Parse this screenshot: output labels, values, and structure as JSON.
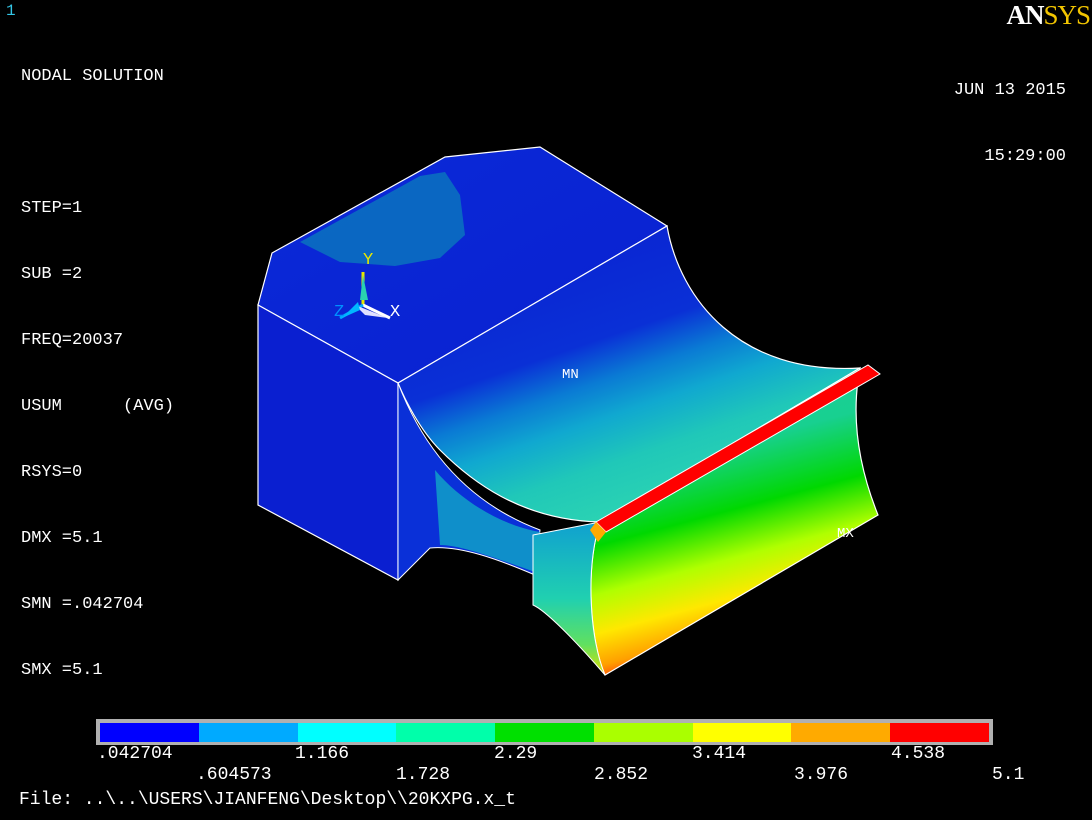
{
  "window_number": "1",
  "logo": {
    "part1": "AN",
    "part2": "SYS"
  },
  "info_lines": [
    "NODAL SOLUTION",
    "",
    "STEP=1",
    "SUB =2",
    "FREQ=20037",
    "USUM      (AVG)",
    "RSYS=0",
    "DMX =5.1",
    "SMN =.042704",
    "SMX =5.1"
  ],
  "date": "JUN 13 2015",
  "time": "15:29:00",
  "markers": {
    "min": "MN",
    "max": "MX"
  },
  "triad": {
    "x": "X",
    "y": "Y",
    "z": "Z"
  },
  "legend": {
    "colors": [
      "#0000ff",
      "#00aaff",
      "#00ffff",
      "#00ffaa",
      "#00e000",
      "#aaff00",
      "#ffff00",
      "#ffaa00",
      "#ff0000"
    ],
    "upper_labels": [
      ".042704",
      "1.166",
      "2.29",
      "3.414",
      "4.538"
    ],
    "lower_labels": [
      ".604573",
      "1.728",
      "2.852",
      "3.976",
      "5.1"
    ]
  },
  "file_line": "File: ..\\..\\USERS\\JIANFENG\\Desktop\\\\20KXPG.x_t"
}
